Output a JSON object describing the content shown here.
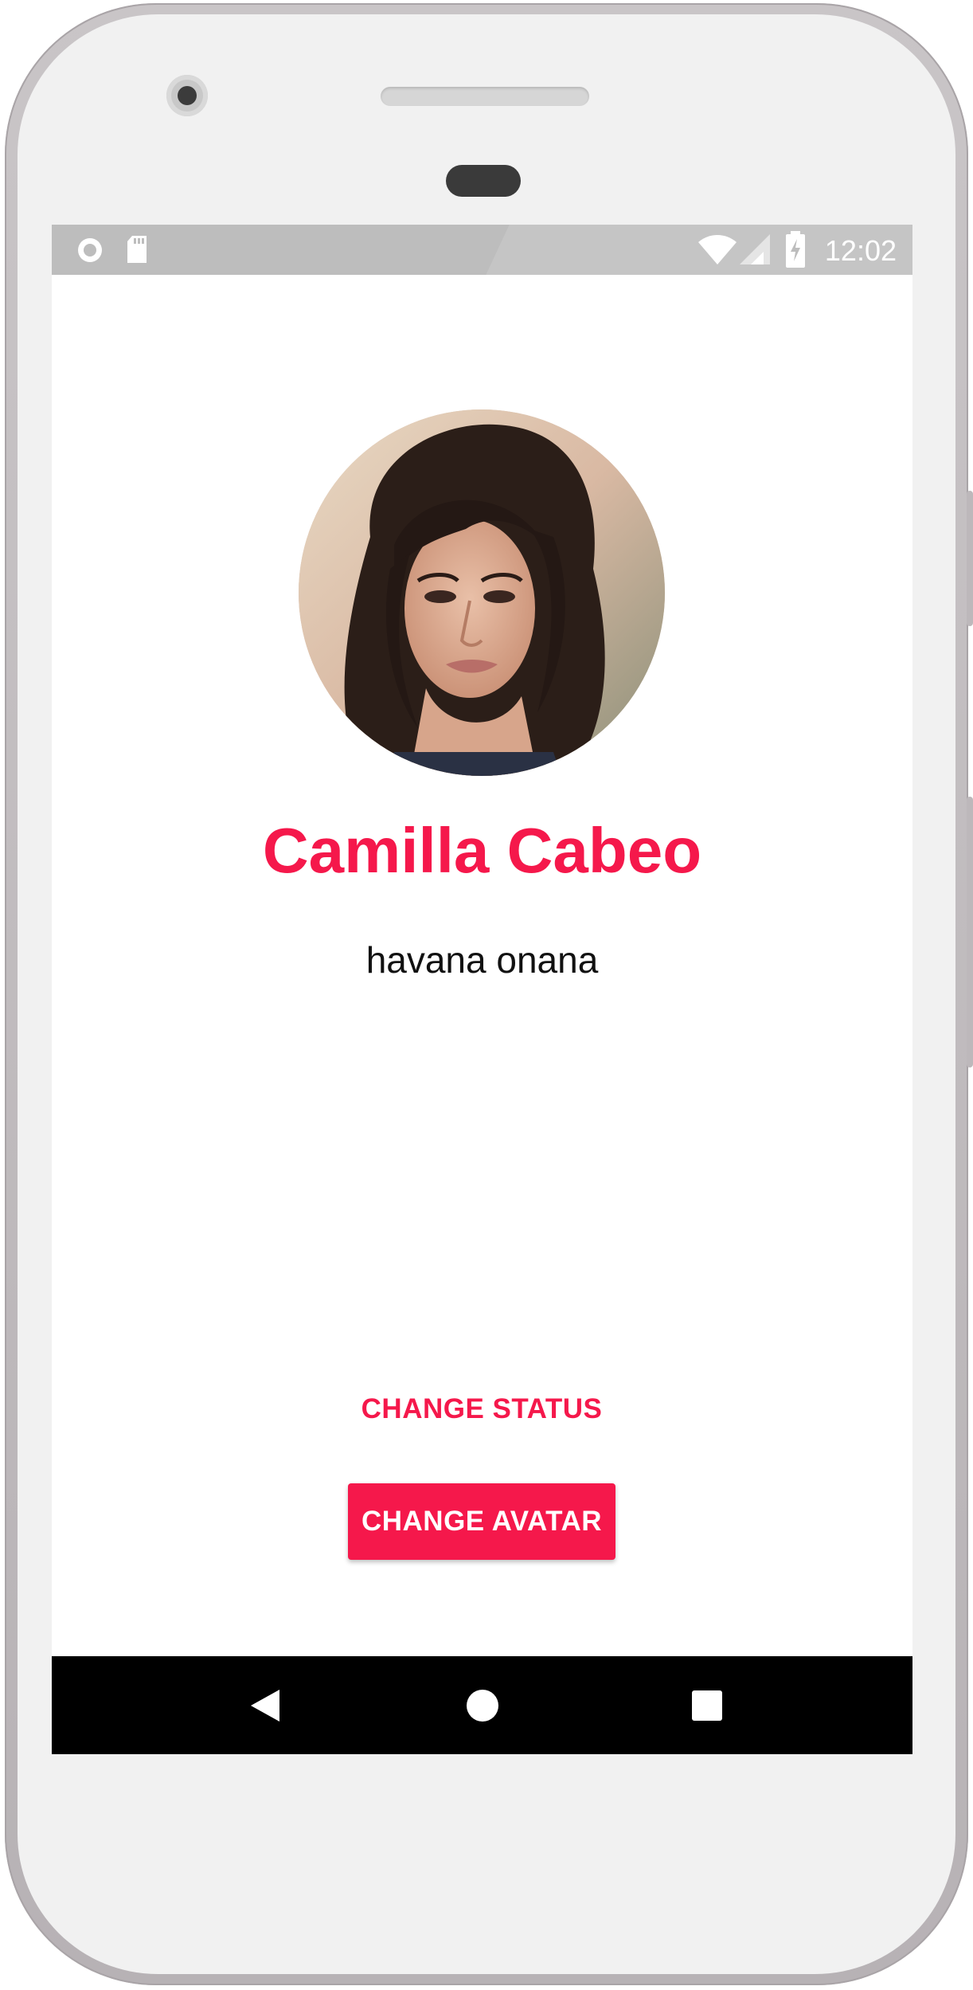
{
  "status_bar": {
    "time": "12:02",
    "icons": [
      "circle-notification-icon",
      "sd-card-icon",
      "wifi-icon",
      "signal-icon",
      "battery-charging-icon"
    ]
  },
  "profile": {
    "avatar_icon": "profile-photo",
    "name": "Camilla Cabeo",
    "status": "havana onana"
  },
  "actions": {
    "change_status_label": "CHANGE STATUS",
    "change_avatar_label": "CHANGE AVATAR"
  },
  "nav_bar": {
    "icons": [
      "back-icon",
      "home-icon",
      "recents-icon"
    ]
  },
  "colors": {
    "accent": "#f5184b",
    "status_bar": "#bdbdbd",
    "nav_bar": "#000000"
  }
}
